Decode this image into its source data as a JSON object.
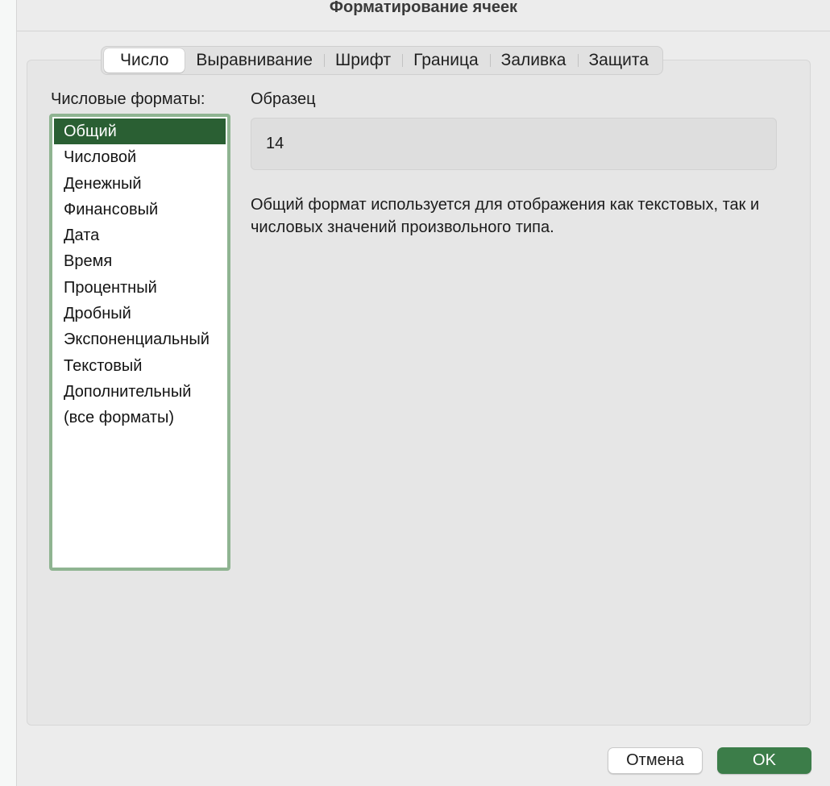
{
  "dialog": {
    "title": "Форматирование ячеек"
  },
  "tabs": [
    {
      "label": "Число",
      "active": true
    },
    {
      "label": "Выравнивание",
      "active": false
    },
    {
      "label": "Шрифт",
      "active": false
    },
    {
      "label": "Граница",
      "active": false
    },
    {
      "label": "Заливка",
      "active": false
    },
    {
      "label": "Защита",
      "active": false
    }
  ],
  "number_tab": {
    "formats_label": "Числовые форматы:",
    "sample_label": "Образец",
    "sample_value": "14",
    "description": "Общий формат используется для отображения как текстовых, так и числовых значений произвольного типа.",
    "formats": [
      "Общий",
      "Числовой",
      "Денежный",
      "Финансовый",
      "Дата",
      "Время",
      "Процентный",
      "Дробный",
      "Экспоненциальный",
      "Текстовый",
      "Дополнительный",
      "(все форматы)"
    ],
    "selected_index": 0
  },
  "buttons": {
    "cancel_label": "Отмена",
    "ok_label": "OK"
  },
  "colors": {
    "selection": "#2a5f33",
    "list_focus_ring": "#8fb491",
    "ok_button": "#3c7d49"
  }
}
